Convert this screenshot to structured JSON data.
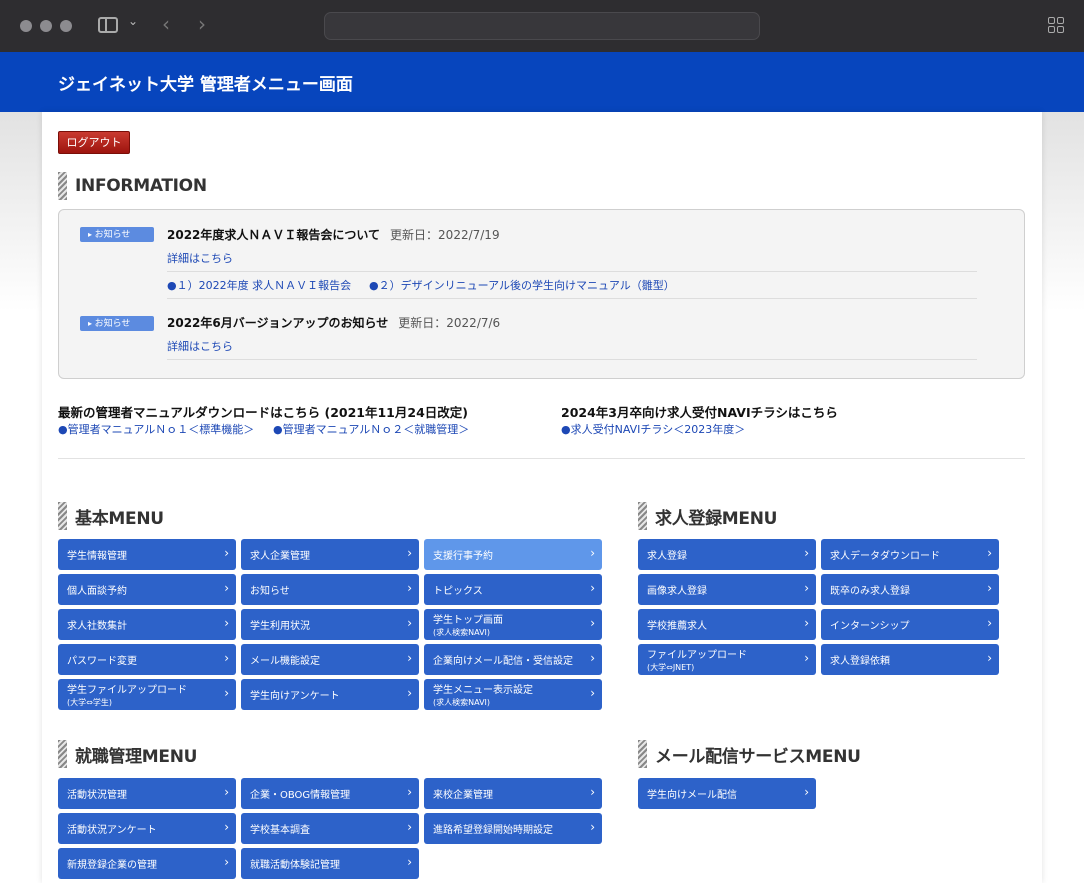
{
  "header": {
    "title": "ジェイネット大学 管理者メニュー画面"
  },
  "logout_label": "ログアウト",
  "info": {
    "title": "INFORMATION",
    "items": [
      {
        "badge": "お知らせ",
        "title": "2022年度求人ＮＡＶＩ報告会について",
        "date": "更新日：2022/7/19",
        "detail": "詳細はこちら",
        "links": [
          "●１）2022年度 求人ＮＡＶＩ報告会",
          "●２）デザインリニューアル後の学生向けマニュアル（雛型）"
        ]
      },
      {
        "badge": "お知らせ",
        "title": "2022年6月バージョンアップのお知らせ",
        "date": "更新日：2022/7/6",
        "detail": "詳細はこちら"
      }
    ]
  },
  "downloads": {
    "manual_title": "最新の管理者マニュアルダウンロードはこちら (2021年11月24日改定)",
    "manual_links": [
      "●管理者マニュアルＮｏ１＜標準機能＞",
      "●管理者マニュアルＮｏ２＜就職管理＞"
    ],
    "flyer_title": "2024年3月卒向け求人受付NAVIチラシはこちら",
    "flyer_links": [
      "●求人受付NAVIチラシ＜2023年度＞"
    ]
  },
  "kihon": {
    "title": "基本MENU",
    "buttons": [
      {
        "label": "学生情報管理"
      },
      {
        "label": "求人企業管理"
      },
      {
        "label": "支援行事予約"
      },
      {
        "label": "個人面談予約"
      },
      {
        "label": "お知らせ"
      },
      {
        "label": "トピックス"
      },
      {
        "label": "求人社数集計"
      },
      {
        "label": "学生利用状況"
      },
      {
        "label": "学生トップ画面",
        "sub": "(求人検索NAVI)"
      },
      {
        "label": "パスワード変更"
      },
      {
        "label": "メール機能設定"
      },
      {
        "label": "企業向けメール配信・受信設定"
      },
      {
        "label": "学生ファイルアップロード",
        "sub": "(大学⇔学生)"
      },
      {
        "label": "学生向けアンケート"
      },
      {
        "label": "学生メニュー表示設定",
        "sub": "(求人検索NAVI)"
      }
    ]
  },
  "kyujin": {
    "title": "求人登録MENU",
    "buttons": [
      {
        "label": "求人登録"
      },
      {
        "label": "求人データダウンロード"
      },
      {
        "label": "画像求人登録"
      },
      {
        "label": "既卒のみ求人登録"
      },
      {
        "label": "学校推薦求人"
      },
      {
        "label": "インターンシップ"
      },
      {
        "label": "ファイルアップロード",
        "sub": "(大学⇔JNET)"
      },
      {
        "label": "求人登録依頼"
      }
    ]
  },
  "shushoku": {
    "title": "就職管理MENU",
    "buttons": [
      {
        "label": "活動状況管理"
      },
      {
        "label": "企業・OBOG情報管理"
      },
      {
        "label": "来校企業管理"
      },
      {
        "label": "活動状況アンケート"
      },
      {
        "label": "学校基本調査"
      },
      {
        "label": "進路希望登録開始時期設定"
      },
      {
        "label": "新規登録企業の管理"
      },
      {
        "label": "就職活動体験記管理"
      }
    ]
  },
  "mail": {
    "title": "メール配信サービスMENU",
    "buttons": [
      {
        "label": "学生向けメール配信"
      }
    ]
  },
  "arrow_glyph": "›"
}
